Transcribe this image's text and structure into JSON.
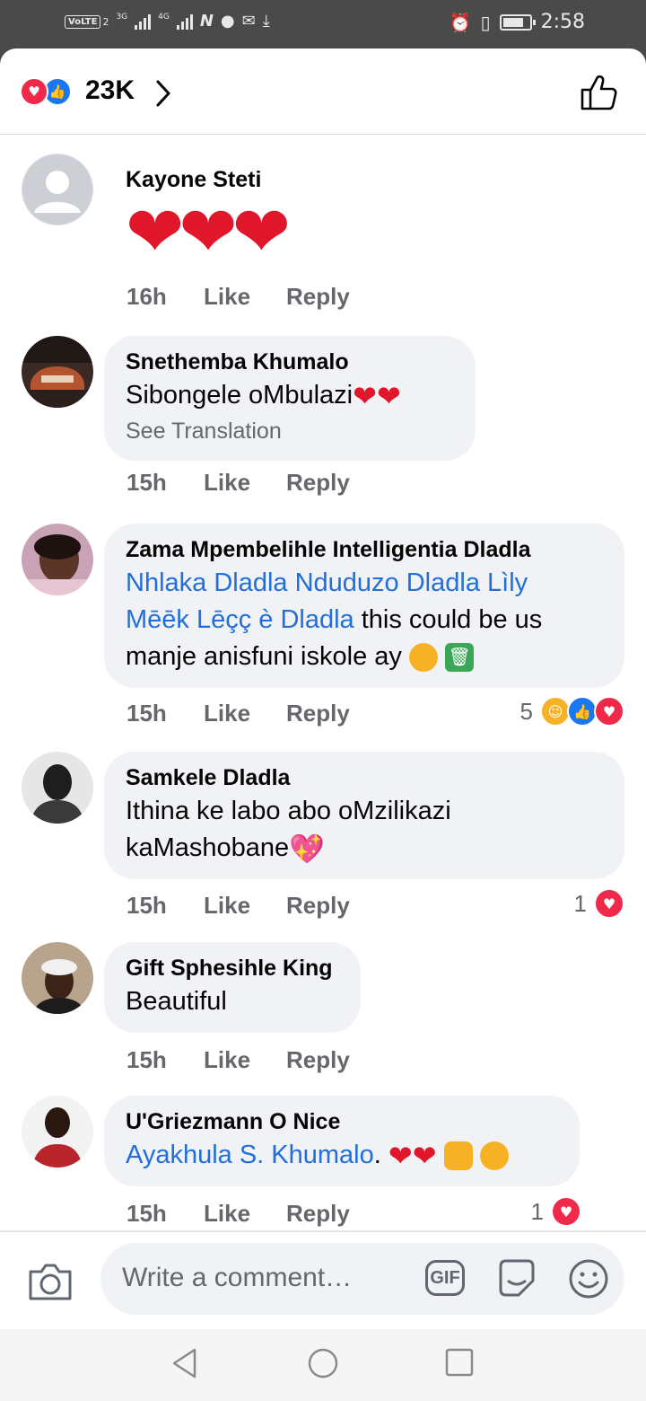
{
  "status_bar": {
    "volte": "VoLTE",
    "sim": "2",
    "net1": "3G",
    "net2": "4G",
    "time": "2:58",
    "icons": [
      "nfc-icon",
      "messenger-icon",
      "mail-icon",
      "download-icon",
      "alarm-icon",
      "vibrate-icon",
      "battery-icon"
    ]
  },
  "reactions_header": {
    "count": "23K",
    "icons": [
      "love-icon",
      "like-icon"
    ]
  },
  "comments": [
    {
      "name": "Kayone Steti",
      "text_emoji": "❤❤❤",
      "time": "16h",
      "like": "Like",
      "reply": "Reply"
    },
    {
      "name": "Snethemba Khumalo",
      "text": "Sibongele oMbulazi",
      "see_translation": "See Translation",
      "time": "15h",
      "like": "Like",
      "reply": "Reply"
    },
    {
      "name": "Zama Mpembelihle Intelligentia Dladla",
      "mention1": "Nhlaka Dladla Nduduzo Dladla  Lìly",
      "mention2": "Mēēk Lēçç è Dladla",
      "text1": "this could be us",
      "text2": "manje anisfuni iskole ay",
      "time": "15h",
      "like": "Like",
      "reply": "Reply",
      "reaction_count": "5"
    },
    {
      "name": "Samkele Dladla",
      "text1": "Ithina ke labo abo oMzilikazi",
      "text2": "kaMashobane",
      "time": "15h",
      "like": "Like",
      "reply": "Reply",
      "reaction_count": "1"
    },
    {
      "name": "Gift Sphesihle King",
      "text": "Beautiful",
      "time": "15h",
      "like": "Like",
      "reply": "Reply"
    },
    {
      "name": "U'Griezmann O Nice",
      "mention": "Ayakhula S. Khumalo",
      "punct": ".",
      "time": "15h",
      "like": "Like",
      "reply": "Reply",
      "reaction_count": "1"
    }
  ],
  "composer": {
    "placeholder": "Write a comment…",
    "gif": "GIF"
  },
  "colors": {
    "accent": "#216fdb",
    "love": "#f02849",
    "like": "#1877f2",
    "bubble": "#f0f2f5"
  }
}
